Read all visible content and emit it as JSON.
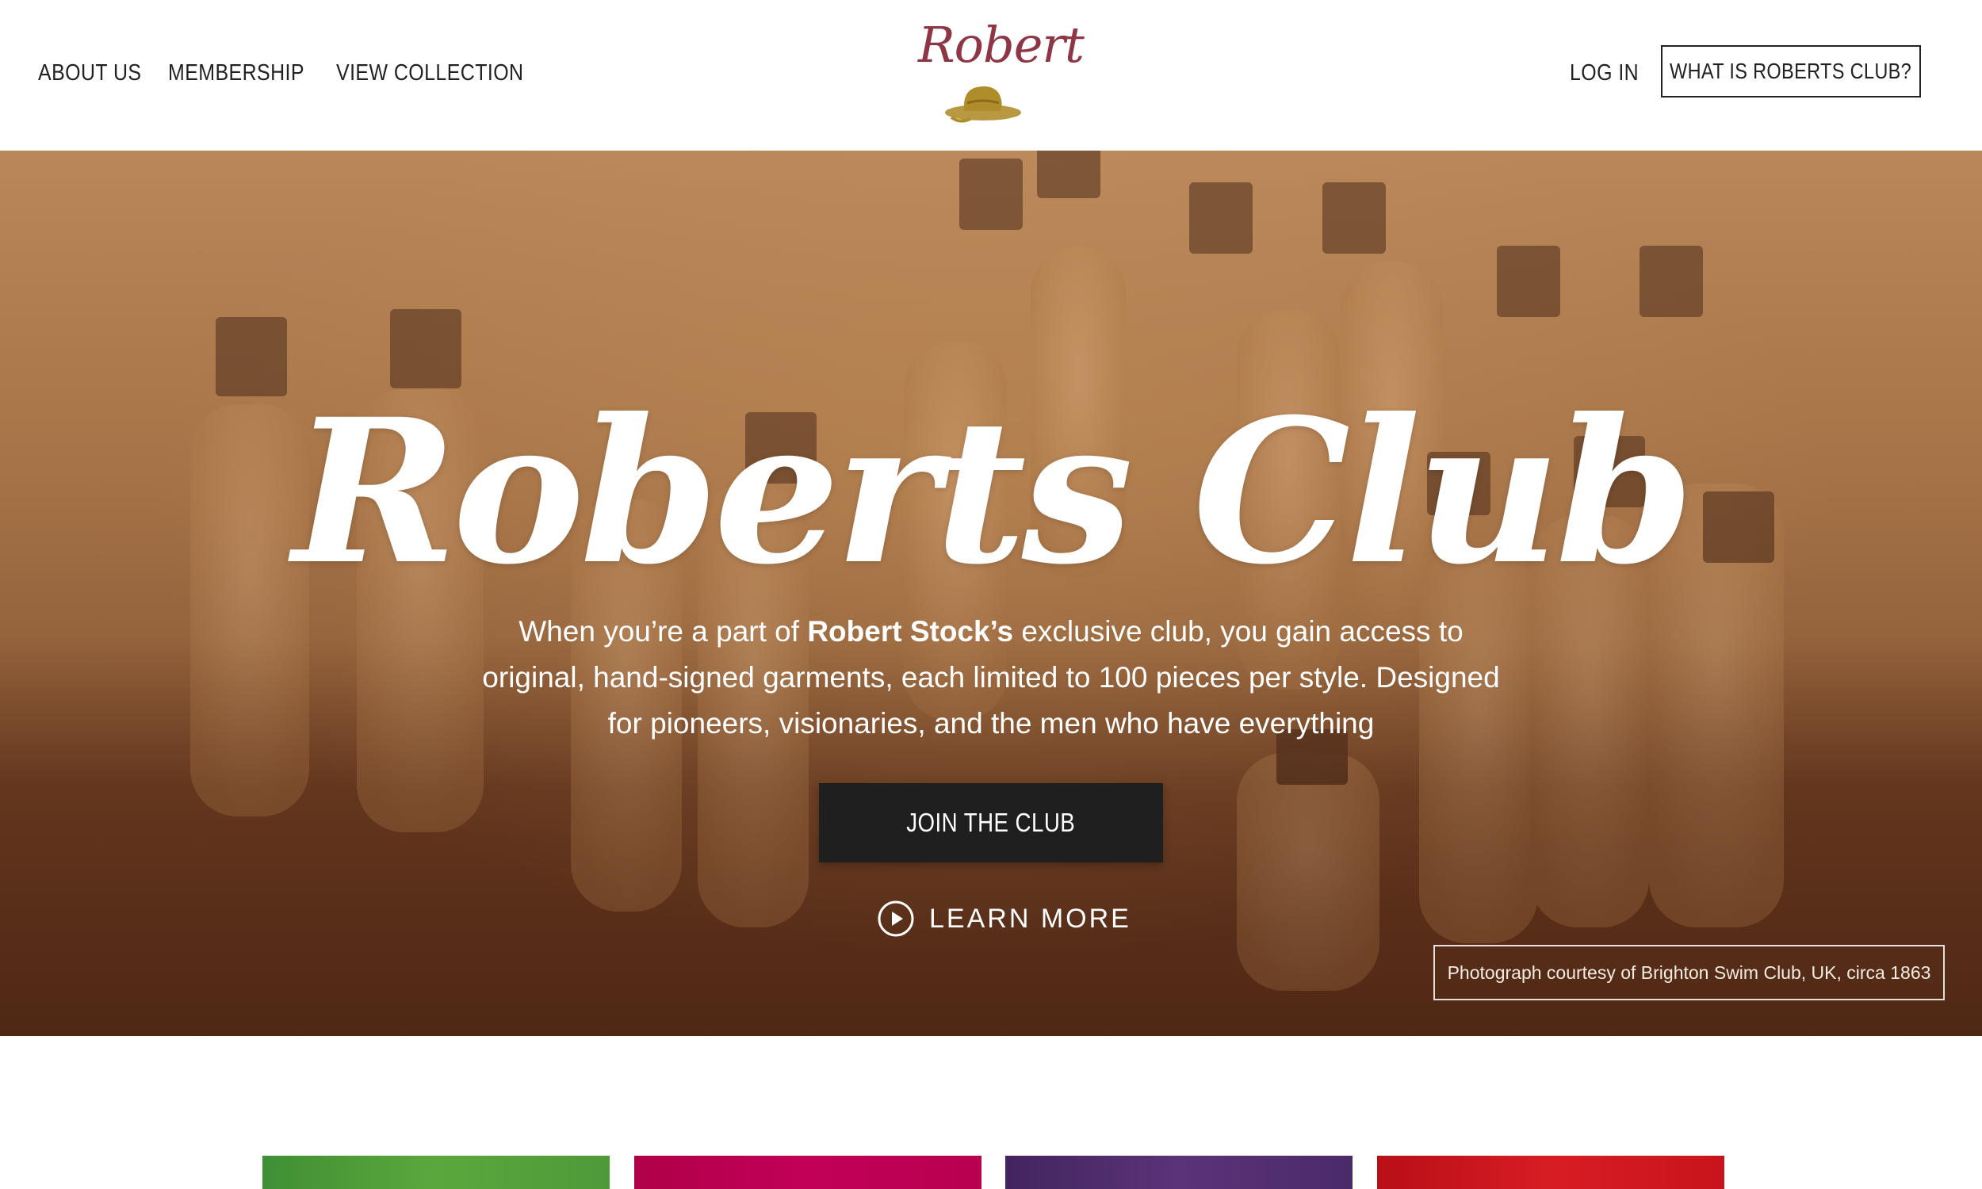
{
  "nav": {
    "items": [
      {
        "label": "ABOUT US"
      },
      {
        "label": "MEMBERSHIP"
      },
      {
        "label": "VIEW COLLECTION"
      }
    ],
    "login_label": "LOG IN",
    "cta_label": "WHAT IS ROBERTS CLUB?"
  },
  "logo": {
    "text": "Robert",
    "icon": "hat-icon",
    "text_color": "#8e3646",
    "icon_color": "#b08d2b"
  },
  "hero": {
    "title": "Roberts Club",
    "text_before": "When you’re a part of ",
    "text_bold": "Robert Stock’s",
    "text_after": " exclusive club, you gain access to original, hand-signed garments, each limited to 100 pieces per style. Designed for pioneers, visionaries, and the men who have everything",
    "join_label": "JOIN THE CLUB",
    "learn_more_label": "LEARN MORE",
    "learn_more_icon": "play-circle-icon",
    "photo_credit": "Photograph courtesy of Brighton Swim Club, UK, circa 1863"
  },
  "tiles": {
    "colors": [
      "#4e9a3a",
      "#b8004f",
      "#4b2a6a",
      "#c8141c"
    ]
  }
}
